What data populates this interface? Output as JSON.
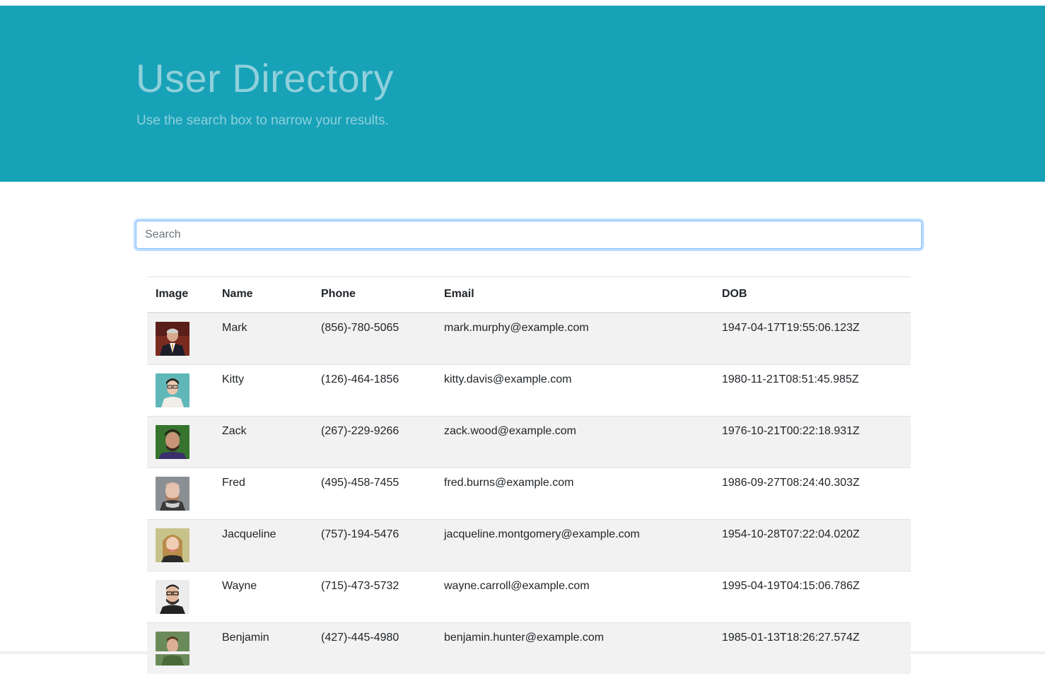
{
  "hero": {
    "title": "User Directory",
    "subtitle": "Use the search box to narrow your results."
  },
  "search": {
    "placeholder": "Search",
    "value": ""
  },
  "table": {
    "headers": [
      "Image",
      "Name",
      "Phone",
      "Email",
      "DOB"
    ],
    "rows": [
      {
        "name": "Mark",
        "phone": "(856)-780-5065",
        "email": "mark.murphy@example.com",
        "dob": "1947-04-17T19:55:06.123Z"
      },
      {
        "name": "Kitty",
        "phone": "(126)-464-1856",
        "email": "kitty.davis@example.com",
        "dob": "1980-11-21T08:51:45.985Z"
      },
      {
        "name": "Zack",
        "phone": "(267)-229-9266",
        "email": "zack.wood@example.com",
        "dob": "1976-10-21T00:22:18.931Z"
      },
      {
        "name": "Fred",
        "phone": "(495)-458-7455",
        "email": "fred.burns@example.com",
        "dob": "1986-09-27T08:24:40.303Z"
      },
      {
        "name": "Jacqueline",
        "phone": "(757)-194-5476",
        "email": "jacqueline.montgomery@example.com",
        "dob": "1954-10-28T07:22:04.020Z"
      },
      {
        "name": "Wayne",
        "phone": "(715)-473-5732",
        "email": "wayne.carroll@example.com",
        "dob": "1995-04-19T04:15:06.786Z"
      },
      {
        "name": "Benjamin",
        "phone": "(427)-445-4980",
        "email": "benjamin.hunter@example.com",
        "dob": "1985-01-13T18:26:27.574Z"
      }
    ]
  },
  "colors": {
    "hero_bg": "#17a2b8",
    "hero_text": "#8fd0db",
    "stripe": "#f2f2f2"
  }
}
